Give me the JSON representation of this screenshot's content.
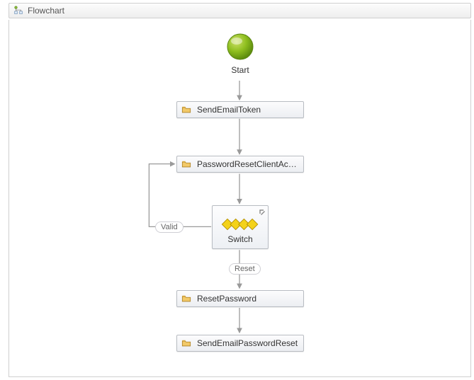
{
  "title": "Flowchart",
  "nodes": {
    "start": {
      "label": "Start"
    },
    "sendEmailToken": {
      "label": "SendEmailToken"
    },
    "passwordResetClient": {
      "label": "PasswordResetClientActivit"
    },
    "switch": {
      "label": "Switch"
    },
    "resetPassword": {
      "label": "ResetPassword"
    },
    "sendEmailPasswordReset": {
      "label": "SendEmailPasswordReset"
    }
  },
  "edges": {
    "switchToClient": {
      "label": "Valid"
    },
    "switchToReset": {
      "label": "Reset"
    }
  },
  "icons": {
    "flowchartHeader": "flowchart-icon",
    "activity": "folder-icon",
    "switch": "diamond-icon"
  }
}
